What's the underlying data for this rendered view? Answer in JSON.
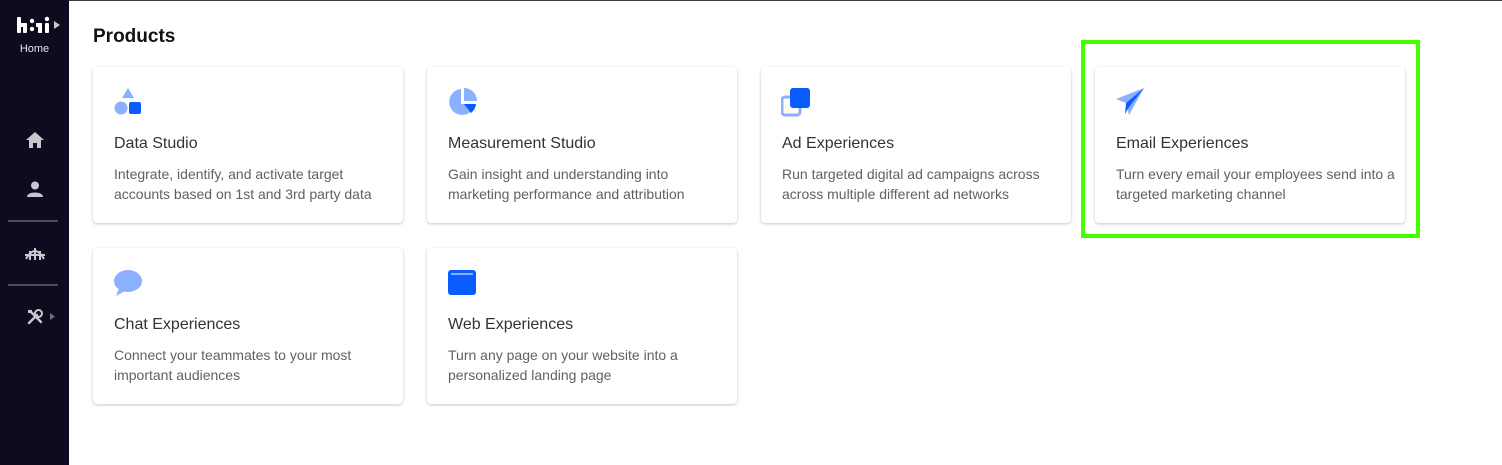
{
  "sidebar": {
    "logo_label": "Home",
    "colors": {
      "background": "#0d0c1f",
      "icon": "#c7c7d0"
    },
    "items": [
      {
        "icon": "home-icon"
      },
      {
        "icon": "user-icon"
      },
      {
        "icon": "bridge-icon"
      },
      {
        "icon": "tools-icon"
      }
    ]
  },
  "page": {
    "title": "Products"
  },
  "products": [
    {
      "title": "Data Studio",
      "description": "Integrate, identify, and activate target accounts based on 1st and 3rd party data",
      "icon": "shapes-icon"
    },
    {
      "title": "Measurement Studio",
      "description": "Gain insight and understanding into marketing performance and attribution",
      "icon": "pie-chart-icon"
    },
    {
      "title": "Ad Experiences",
      "description": "Run targeted digital ad campaigns across across multiple different ad networks",
      "icon": "stacked-squares-icon"
    },
    {
      "title": "Email Experiences",
      "description": "Turn every email your employees send into a targeted marketing channel",
      "icon": "paper-plane-icon"
    },
    {
      "title": "Chat Experiences",
      "description": "Connect your teammates to your most important audiences",
      "icon": "chat-bubble-icon"
    },
    {
      "title": "Web Experiences",
      "description": "Turn any page on your website into a personalized landing page",
      "icon": "browser-window-icon"
    }
  ],
  "colors": {
    "icon_light": "#8ab0ff",
    "icon_dark": "#0b5cff",
    "highlight": "#44ff00"
  }
}
